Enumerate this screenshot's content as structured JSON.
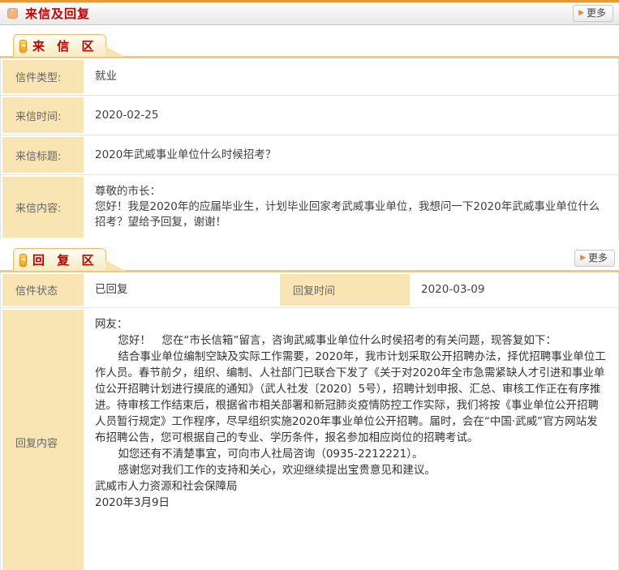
{
  "page_header": {
    "title": "来信及回复",
    "more_label": "更多"
  },
  "letter_section": {
    "tab_label": "来 信 区",
    "rows": [
      {
        "label": "信件类型:",
        "value": "就业"
      },
      {
        "label": "来信时间:",
        "value": "2020-02-25"
      },
      {
        "label": "来信标题:",
        "value": "2020年武威事业单位什么时候招考？"
      }
    ],
    "content_row": {
      "label": "来信内容:",
      "line1": "尊敬的市长：",
      "line2": "您好！我是2020年的应届毕业生，计划毕业回家考武威事业单位，我想问一下2020年武威事业单位什么招考？望给予回复，谢谢！"
    }
  },
  "reply_section": {
    "tab_label": "回 复 区",
    "more_label": "更多",
    "status_row": {
      "status_label": "信件状态",
      "status_value": "已回复",
      "time_label": "回复时间",
      "time_value": "2020-03-09"
    },
    "content_row": {
      "label": "回复内容",
      "salutation": "网友：",
      "paragraphs": [
        "您好！　您在“市长信箱”留言，咨询武威事业单位什么时侯招考的有关问题，现答复如下：",
        "结合事业单位编制空缺及实际工作需要，2020年，我市计划采取公开招聘办法，择优招聘事业单位工作人员。春节前夕，组织、编制、人社部门已联合下发了《关于对2020年全市急需紧缺人才引进和事业单位公开招聘计划进行摸底的通知》（武人社发〔2020〕5号），招聘计划申报、汇总、审核工作正在有序推进。待审核工作结束后，根据省市相关部署和新冠肺炎疫情防控工作实际，我们将按《事业单位公开招聘人员暂行规定》工作程序，尽早组织实施2020年事业单位公开招聘。届时，会在“中国·武威”官方网站发布招聘公告，您可根据自己的专业、学历条件，报名参加相应岗位的招聘考试。",
        "如您还有不清楚事宜，可向市人社局咨询（0935-2212221）。",
        "感谢您对我们工作的支持和关心，欢迎继续提出宝贵意见和建议。"
      ],
      "signature": "武威市人力资源和社会保障局",
      "date": "2020年3月9日"
    }
  },
  "colors": {
    "accent_orange": "#ee9738",
    "title_red": "#c50000",
    "tab_text_red": "#b80000",
    "label_bg": "#f9e5b4",
    "gold_line": "#eecb76",
    "more_arrow": "#ef8b1d"
  },
  "icons": {
    "header_collapse": "chevron-down",
    "more_arrow": "triangle-right",
    "tab_bullet": "gold-tag"
  }
}
